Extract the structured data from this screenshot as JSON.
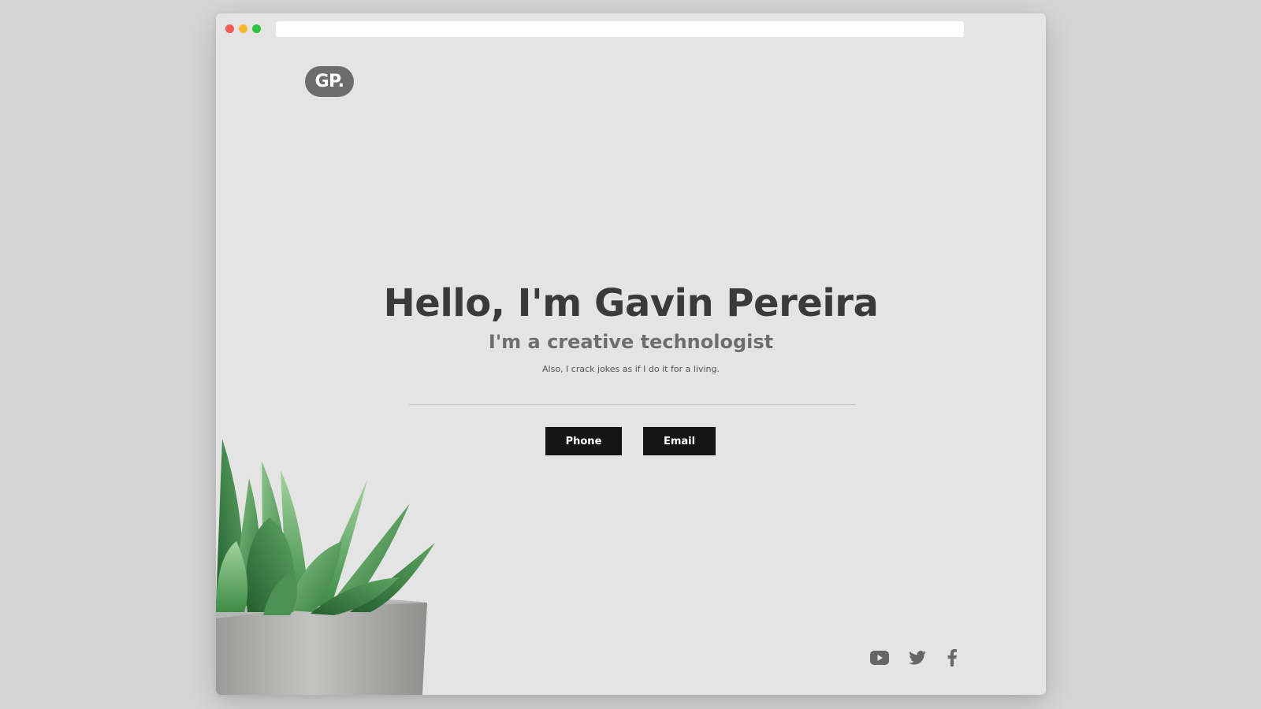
{
  "window": {
    "address_bar": {
      "value": ""
    }
  },
  "brand": {
    "logo_text": "GP."
  },
  "hero": {
    "title": "Hello, I'm Gavin Pereira",
    "subtitle": "I'm a creative technologist",
    "tagline": "Also, I crack jokes as if I do it for a living."
  },
  "actions": {
    "phone_label": "Phone",
    "email_label": "Email"
  },
  "social": [
    {
      "icon": "youtube-icon"
    },
    {
      "icon": "twitter-icon"
    },
    {
      "icon": "facebook-icon"
    }
  ],
  "colors": {
    "page_background": "#e4e4e4",
    "button_background": "#151515",
    "logo_background": "#6d6d6d",
    "heading_text": "#3a3a3a",
    "icon_color": "#666666"
  }
}
